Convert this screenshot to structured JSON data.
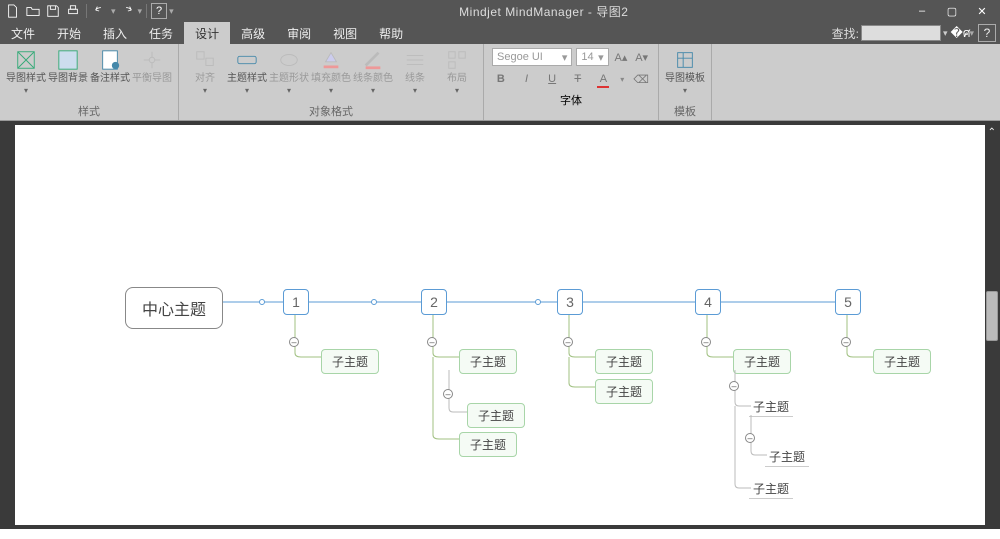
{
  "title": "Mindjet MindManager - 导图2",
  "menubar": {
    "items": [
      "文件",
      "开始",
      "插入",
      "任务",
      "设计",
      "高级",
      "审阅",
      "视图",
      "帮助"
    ],
    "active_index": 4,
    "search_label": "查找:"
  },
  "ribbon": {
    "groups": {
      "style": {
        "label": "样式",
        "buttons": [
          "导图样式",
          "导图背景",
          "备注样式",
          "平衡导图"
        ]
      },
      "format": {
        "label": "对象格式",
        "buttons": [
          "对齐",
          "主题样式",
          "主题形状",
          "填充颜色",
          "线条颜色",
          "线条",
          "布局"
        ]
      },
      "font": {
        "label": "字体",
        "family": "Segoe UI",
        "size": "14"
      },
      "template": {
        "label": "模板",
        "button": "导图模板"
      }
    }
  },
  "mindmap": {
    "center": "中心主题",
    "mains": [
      "1",
      "2",
      "3",
      "4",
      "5"
    ],
    "sub_label": "子主题"
  }
}
